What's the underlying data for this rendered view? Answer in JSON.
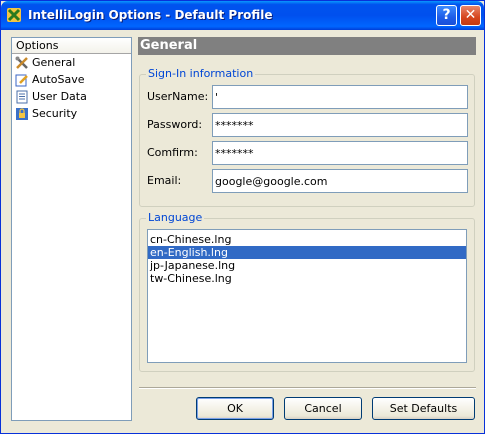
{
  "window": {
    "title": "IntelliLogin Options - Default Profile"
  },
  "titlebar": {
    "help_label": "?",
    "close_label": "✕"
  },
  "sidebar": {
    "header": "Options",
    "items": [
      {
        "label": "General",
        "icon": "tools-icon"
      },
      {
        "label": "AutoSave",
        "icon": "pencil-icon"
      },
      {
        "label": "User Data",
        "icon": "document-icon"
      },
      {
        "label": "Security",
        "icon": "lock-icon"
      }
    ]
  },
  "main": {
    "section_title": "General",
    "signin": {
      "label": "Sign-In information",
      "username_label": "UserName:",
      "username_value": "'",
      "password_label": "Password:",
      "password_value": "*******",
      "confirm_label": "Comfirm:",
      "confirm_value": "*******",
      "email_label": "Email:",
      "email_value": "google@google.com"
    },
    "language": {
      "label": "Language",
      "options": [
        "cn-Chinese.lng",
        "en-English.lng",
        "jp-Japanese.lng",
        "tw-Chinese.lng"
      ],
      "selected": "en-English.lng"
    }
  },
  "buttons": {
    "ok": "OK",
    "cancel": "Cancel",
    "set_defaults": "Set Defaults"
  },
  "colors": {
    "titlebar": "#0054e3",
    "selection": "#316ac5",
    "group_label": "#0046d5",
    "section_header": "#808080"
  }
}
